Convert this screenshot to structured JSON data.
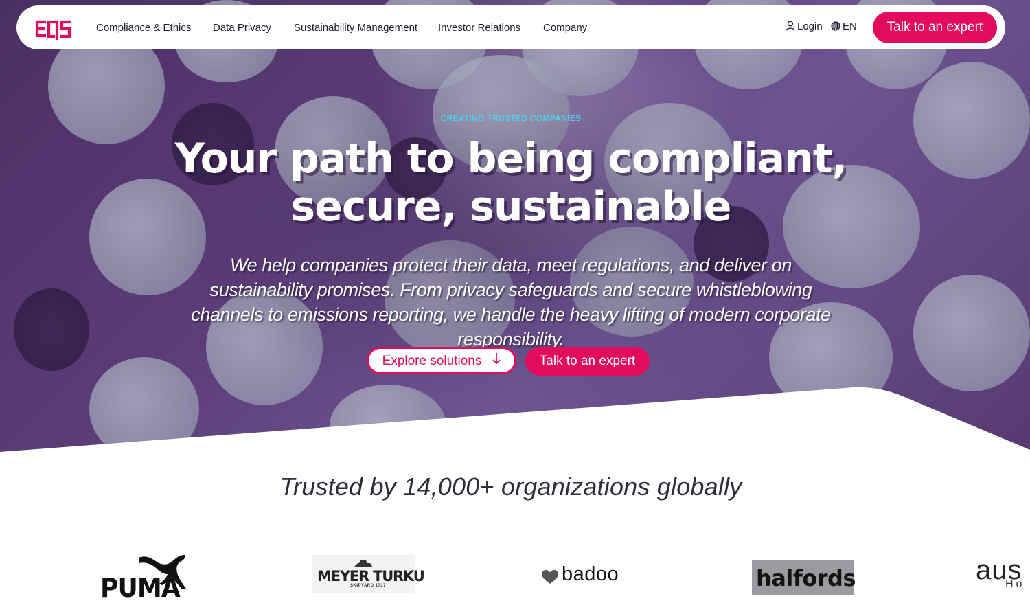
{
  "nav": {
    "logo_text": "EQS",
    "links": [
      "Compliance & Ethics",
      "Data Privacy",
      "Sustainability Management",
      "Investor Relations",
      "Company"
    ],
    "login_label": "Login",
    "language_label": "EN",
    "cta_label": "Talk to an expert"
  },
  "hero": {
    "kicker": "CREATING TRUSTED COMPANIES",
    "headline_line1": "Your path to being compliant,",
    "headline_line2": "secure, sustainable",
    "lede": "We help companies protect their data, meet regulations, and deliver on sustainability promises. From privacy safeguards and secure whistleblowing channels to emissions reporting, we handle the heavy lifting of modern corporate responsibility.",
    "primary_button": "Explore solutions",
    "secondary_button": "Talk to an expert"
  },
  "trusted": {
    "heading": "Trusted by 14,000+ organizations globally",
    "logos": [
      {
        "name": "puma",
        "text": "PUMA"
      },
      {
        "name": "meyer-turku",
        "text": "MEYER TURKU",
        "subtext": "SKIPYARD 1737"
      },
      {
        "name": "badoo",
        "text": "badoo"
      },
      {
        "name": "halfords",
        "text": "halfords"
      },
      {
        "name": "aus",
        "text": "aus",
        "subtext": "Ho"
      }
    ]
  },
  "colors": {
    "brand": "#e30b5c",
    "hero_kicker": "#4fd0e8",
    "hero_bg": "#5b3d78"
  },
  "icons": {
    "login": "user-icon",
    "language": "globe-icon",
    "explore": "arrow-down-icon"
  }
}
